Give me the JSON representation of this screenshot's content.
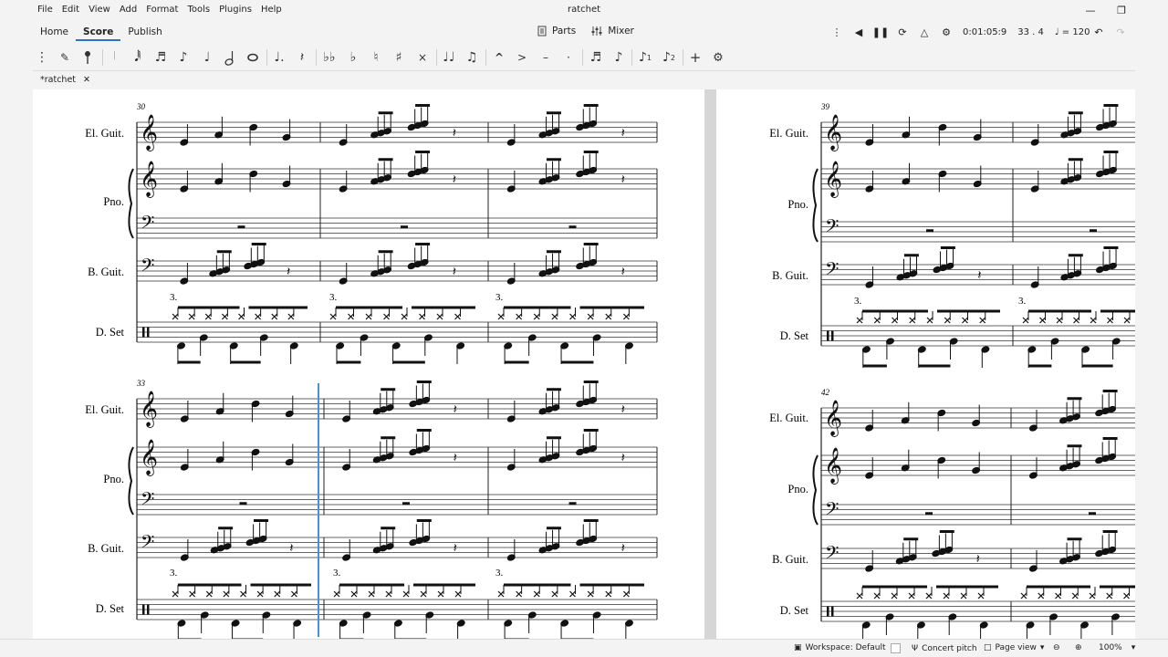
{
  "app": {
    "title": "ratchet",
    "menu": [
      "File",
      "Edit",
      "View",
      "Add",
      "Format",
      "Tools",
      "Plugins",
      "Help"
    ]
  },
  "nav": {
    "tabs": [
      "Home",
      "Score",
      "Publish"
    ],
    "active_tab": "Score",
    "parts_label": "Parts",
    "mixer_label": "Mixer"
  },
  "playback": {
    "time": "0:01:05:9",
    "position": "33 . 4",
    "tempo": "♩ = 120"
  },
  "toolbar": {
    "icons": [
      "grip-icon",
      "pen-icon",
      "note-input-icon",
      "64th-note-icon",
      "32nd-note-icon",
      "16th-note-icon",
      "8th-note-icon",
      "quarter-note-icon",
      "half-note-icon",
      "whole-note-icon",
      "augmentation-dot-icon",
      "rest-icon",
      "double-flat-icon",
      "flat-icon",
      "natural-icon",
      "sharp-icon",
      "double-sharp-icon",
      "tie-icon",
      "slur-icon",
      "accent-icon",
      "marcato-icon",
      "tenuto-icon",
      "staccato-icon",
      "tuplet-icon",
      "flip-icon",
      "voice1-icon",
      "voice2-icon",
      "add-icon",
      "toolbar-settings-icon"
    ]
  },
  "document_tab": {
    "label": "*ratchet"
  },
  "score": {
    "systems": [
      {
        "measure_number": "30",
        "labels": [
          "El. Guit.",
          "Pno.",
          "B. Guit.",
          "D. Set"
        ],
        "tuplet": "3."
      },
      {
        "measure_number": "33",
        "labels": [
          "El. Guit.",
          "Pno.",
          "B. Guit.",
          "D. Set"
        ],
        "tuplet": "3."
      },
      {
        "measure_number": "39",
        "labels": [
          "El. Guit.",
          "Pno.",
          "B. Guit.",
          "D. Set"
        ],
        "tuplet": "3."
      },
      {
        "measure_number": "42",
        "labels": [
          "El. Guit.",
          "Pno.",
          "B. Guit.",
          "D. Set"
        ],
        "tuplet": ""
      }
    ]
  },
  "status": {
    "workspace": "Workspace: Default",
    "concert_pitch": "Concert pitch",
    "page_view": "Page view",
    "zoom": "100%"
  },
  "colors": {
    "accent": "#2b72c9",
    "cursor": "#4a8fd8"
  }
}
